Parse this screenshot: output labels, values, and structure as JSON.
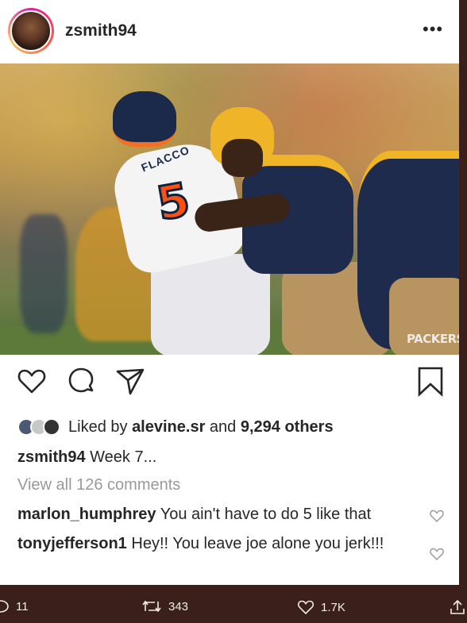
{
  "post": {
    "username": "zsmith94",
    "more_icon": "ellipsis-icon",
    "photo_watermark": "PACKERS",
    "jersey_name": "FLACCO",
    "jersey_number": "5"
  },
  "likes": {
    "prefix": "Liked by",
    "user": "alevine.sr",
    "connector": "and",
    "others": "9,294 others"
  },
  "caption": {
    "user": "zsmith94",
    "text": "Week 7..."
  },
  "comments": {
    "view_all": "View all 126 comments",
    "items": [
      {
        "user": "marlon_humphrey",
        "text": "You ain't have to do 5 like that"
      },
      {
        "user": "tonyjefferson1",
        "text": "Hey!! You leave joe alone you jerk!!!"
      }
    ]
  },
  "tweet_actions": {
    "replies": "11",
    "retweets": "343",
    "likes": "1.7K"
  },
  "colors": {
    "text": "#262626",
    "muted": "#9a9a9a",
    "frame": "#3a1f1a"
  }
}
